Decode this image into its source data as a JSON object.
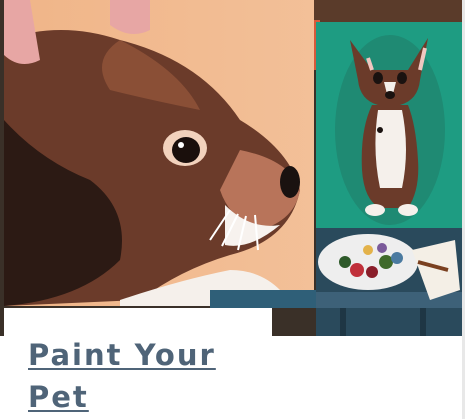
{
  "card": {
    "image": {
      "description_icon": "pet-portrait-photo",
      "colors": {
        "left_canvas_bg": "#f0b588",
        "dog_brown": "#6b3b2a",
        "dog_dark": "#2c1a14",
        "right_canvas_bg": "#1e9c82",
        "palette_white": "#eeeeee"
      }
    },
    "title": "Paint Your Pet",
    "title_color": "#4f6478"
  }
}
